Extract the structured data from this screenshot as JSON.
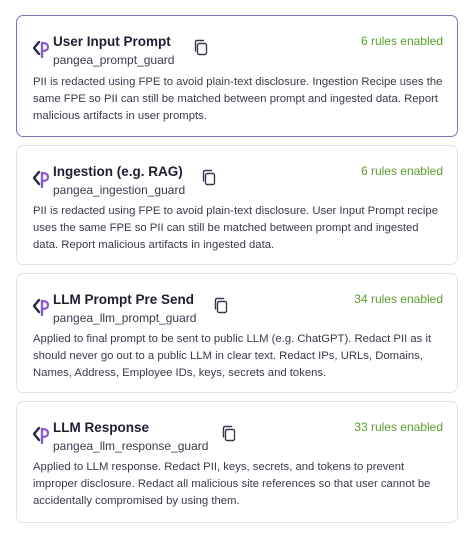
{
  "cards": [
    {
      "title": "User Input Prompt",
      "slug": "pangea_prompt_guard",
      "rules": "6 rules enabled",
      "description": "PII is redacted using FPE to avoid plain-text disclosure. Ingestion Recipe uses the same FPE so PII can still be matched between prompt and ingested data. Report malicious artifacts in user prompts.",
      "selected": true
    },
    {
      "title": "Ingestion (e.g. RAG)",
      "slug": "pangea_ingestion_guard",
      "rules": "6 rules enabled",
      "description": "PII is redacted using FPE to avoid plain-text disclosure. User Input Prompt recipe uses the same FPE so PII can still be matched between prompt and ingested data. Report malicious artifacts in ingested data.",
      "selected": false
    },
    {
      "title": "LLM Prompt Pre Send",
      "slug": "pangea_llm_prompt_guard",
      "rules": "34 rules enabled",
      "description": "Applied to final prompt to be sent to public LLM (e.g. ChatGPT). Redact PII as it should never go out to a public LLM in clear text. Redact IPs, URLs, Domains, Names, Address, Employee IDs, keys, secrets and tokens.",
      "selected": false
    },
    {
      "title": "LLM Response",
      "slug": "pangea_llm_response_guard",
      "rules": "33 rules enabled",
      "description": "Applied to LLM response. Redact PII, keys, secrets, and tokens to prevent improper disclosure. Redact all malicious site references so that user cannot be accidentally compromised by using them.",
      "selected": false
    }
  ],
  "icons": {
    "logo": "pangea-logo-icon",
    "copy": "copy-icon"
  },
  "colors": {
    "selected_border": "#8a6fb0",
    "rules_text": "#5aa02c",
    "logo_dark": "#1f2a44",
    "logo_accent": "#8a5cc9"
  }
}
